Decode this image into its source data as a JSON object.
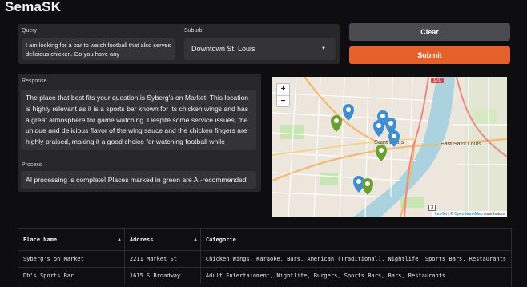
{
  "app": {
    "title": "SemaSK"
  },
  "query": {
    "label": "Query",
    "value": "I am looking for a bar to watch football that also serves delicious chicken. Do you have any"
  },
  "suburb": {
    "label": "Suburb",
    "selected": "Downtown St. Louis",
    "chevron_icon": "chevron-down-icon"
  },
  "buttons": {
    "clear": "Clear",
    "submit": "Submit",
    "submit_color": "#e4622a",
    "clear_color": "#4a4a50"
  },
  "response": {
    "label": "Response",
    "text": "The place that best fits your question is Syberg's on Market. This location is highly relevant as it is a sports bar known for its chicken wings and has a great atmosphere for game watching. Despite some service issues, the unique and delicious flavor of the wing sauce and the chicken fingers are highly praised, making it a good choice for watching football while enjoying chicken.There are a number of other places that may be of"
  },
  "process": {
    "label": "Process",
    "text": "AI processing is complete! Places marked in green are AI-recommended"
  },
  "map": {
    "zoom_in": "+",
    "zoom_out": "−",
    "place_label": "Saint Louis",
    "east_label": "East Saint Louis",
    "route_170": "170",
    "route_3": "3",
    "attribution_leaflet": "Leaflet",
    "attribution_sep": " | © ",
    "attribution_osm": "OpenStreetMap",
    "attribution_tail": " contributors",
    "marker_colors": {
      "ai": "#6aa12e",
      "other": "#3f8fd0"
    }
  },
  "table": {
    "headers": [
      "Place Name",
      "Address",
      "Categorie"
    ],
    "rows": [
      [
        "Syberg's on Market",
        "2211 Market St",
        "Chicken Wings, Karaoke, Bars, American (Traditional), Nightlife, Sports Bars, Restaurants"
      ],
      [
        "Db's Sports Bar",
        "1615 S Broadway",
        "Adult Entertainment, Nightlife, Burgers, Sports Bars, Bars, Restaurants"
      ]
    ]
  }
}
